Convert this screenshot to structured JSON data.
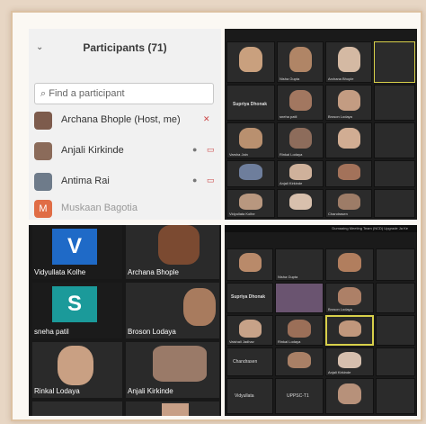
{
  "participants_panel": {
    "title": "Participants (71)",
    "search_placeholder": "Find a participant",
    "items": [
      {
        "name": "Archana Bhople (Host, me)",
        "avatar_color": "#7d5b4c"
      },
      {
        "name": "Anjali Kirkinde",
        "avatar_color": "#8b6b5a"
      },
      {
        "name": "Antima Rai",
        "avatar_color": "#6e7b8a"
      },
      {
        "name": "Muskaan Bagotia",
        "avatar_color": "#e06d46",
        "letter": "M"
      }
    ]
  },
  "gallery_top": {
    "labels": [
      "Nisha Gupta",
      "Archana Bhople",
      "Supriya Dhonak",
      "sneha patil",
      "Broson Lodaya",
      "Rinkal Lodaya",
      "Anjali Kirkinde",
      "Vidyullata Kolhe",
      "Varsha Jain",
      "Chandrasen"
    ],
    "highlight": "#d8d04a"
  },
  "gallery_bottom": {
    "banner": "Dumaaing Meeting Team (NCD) Upgrade Ja Ke",
    "labels": [
      "Nisha Gupta",
      "Supriya Dhonak",
      "Broson Lodaya",
      "Vaishali Jadhav",
      "Rinkal Lodaya",
      "Anjali Kirkinde",
      "Chandrasen",
      "Vidyullata",
      "UPPSC-T1"
    ]
  },
  "big_gallery": {
    "tiles": [
      {
        "label": "Vidyullata Kolhe",
        "letter": "V",
        "color": "#1f6ac7"
      },
      {
        "label": "Archana Bhople",
        "photo": true
      },
      {
        "label": "sneha patil",
        "letter": "S",
        "color": "#1b9a9a"
      },
      {
        "label": "Broson Lodaya",
        "photo": true
      },
      {
        "label": "Rinkal Lodaya",
        "photo": true
      },
      {
        "label": "Anjali Kirkinde",
        "photo": true
      }
    ]
  }
}
